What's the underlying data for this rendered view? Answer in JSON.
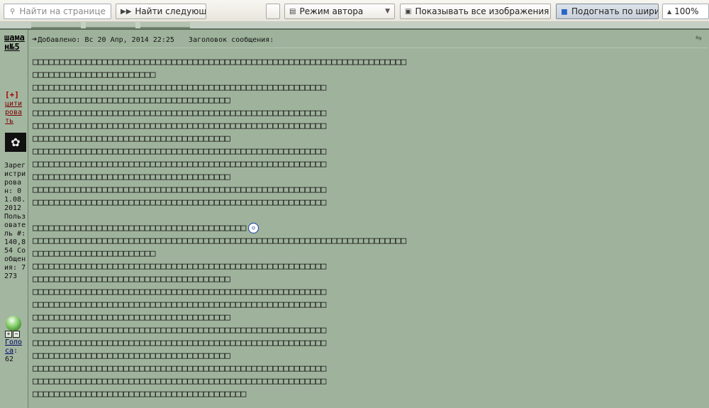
{
  "toolbar": {
    "search_placeholder": "Найти на странице",
    "find_next_label": "Найти следующее",
    "author_mode_label": "Режим автора",
    "show_images_label": "Показывать все изображения",
    "fit_width_label": "Подогнать по ширине",
    "zoom_value": "100%"
  },
  "user": {
    "name": "шаман№5",
    "plus": "[+]",
    "quote_label": "цитировать",
    "registered_label": "Зарегистрирован:",
    "registered_date": "01.08.2012",
    "user_number_label": "Пользователь #:",
    "user_number": "140,854",
    "messages_label": "Сообщения:",
    "messages_count": "7273",
    "votes_label": "Голоса",
    "votes_count": "62"
  },
  "post": {
    "added_label": "Добавлено: Вс 20 Апр, 2014 22:25",
    "subject_label": "Заголовок сообщения:",
    "lines": [
      "□□□□□□□□□□□□□□□□□□□□□□□□□□□□□□□□□□□□□□□□□□□□□□□□□□□□□□□□□□□□□□□□□□□□□□",
      "□□□□□□□□□□□□□□□□□□□□□□□",
      "□□□□□□□□□□□□□□□□□□□□□□□□□□□□□□□□□□□□□□□□□□□□□□□□□□□□□□□",
      "□□□□□□□□□□□□□□□□□□□□□□□□□□□□□□□□□□□□□",
      "□□□□□□□□□□□□□□□□□□□□□□□□□□□□□□□□□□□□□□□□□□□□□□□□□□□□□□□",
      "□□□□□□□□□□□□□□□□□□□□□□□□□□□□□□□□□□□□□□□□□□□□□□□□□□□□□□□",
      "□□□□□□□□□□□□□□□□□□□□□□□□□□□□□□□□□□□□□",
      "□□□□□□□□□□□□□□□□□□□□□□□□□□□□□□□□□□□□□□□□□□□□□□□□□□□□□□□",
      "□□□□□□□□□□□□□□□□□□□□□□□□□□□□□□□□□□□□□□□□□□□□□□□□□□□□□□□",
      "□□□□□□□□□□□□□□□□□□□□□□□□□□□□□□□□□□□□□",
      "□□□□□□□□□□□□□□□□□□□□□□□□□□□□□□□□□□□□□□□□□□□□□□□□□□□□□□□",
      "□□□□□□□□□□□□□□□□□□□□□□□□□□□□□□□□□□□□□□□□□□□□□□□□□□□□□□□",
      "",
      "□□□□□□□□□□□□□□□□□□□□□□□□□□□□□□□□□□□□□□□□",
      "□□□□□□□□□□□□□□□□□□□□□□□□□□□□□□□□□□□□□□□□□□□□□□□□□□□□□□□□□□□□□□□□□□□□□□",
      "□□□□□□□□□□□□□□□□□□□□□□□",
      "□□□□□□□□□□□□□□□□□□□□□□□□□□□□□□□□□□□□□□□□□□□□□□□□□□□□□□□",
      "□□□□□□□□□□□□□□□□□□□□□□□□□□□□□□□□□□□□□",
      "□□□□□□□□□□□□□□□□□□□□□□□□□□□□□□□□□□□□□□□□□□□□□□□□□□□□□□□",
      "□□□□□□□□□□□□□□□□□□□□□□□□□□□□□□□□□□□□□□□□□□□□□□□□□□□□□□□",
      "□□□□□□□□□□□□□□□□□□□□□□□□□□□□□□□□□□□□□",
      "□□□□□□□□□□□□□□□□□□□□□□□□□□□□□□□□□□□□□□□□□□□□□□□□□□□□□□□",
      "□□□□□□□□□□□□□□□□□□□□□□□□□□□□□□□□□□□□□□□□□□□□□□□□□□□□□□□",
      "□□□□□□□□□□□□□□□□□□□□□□□□□□□□□□□□□□□□□",
      "□□□□□□□□□□□□□□□□□□□□□□□□□□□□□□□□□□□□□□□□□□□□□□□□□□□□□□□",
      "□□□□□□□□□□□□□□□□□□□□□□□□□□□□□□□□□□□□□□□□□□□□□□□□□□□□□□□",
      "□□□□□□□□□□□□□□□□□□□□□□□□□□□□□□□□□□□□□□□□"
    ],
    "smiley_line": 13
  },
  "icons": {
    "search": "search-icon",
    "find_next": "find-next-icon",
    "author_mode": "author-mode-icon",
    "show_images": "image-icon",
    "fit_width": "fit-width-icon",
    "zoom": "zoom-arrow-icon",
    "post_arrow": "post-arrow-icon",
    "smiley": "smiley-icon",
    "expand": "expand-icon"
  }
}
